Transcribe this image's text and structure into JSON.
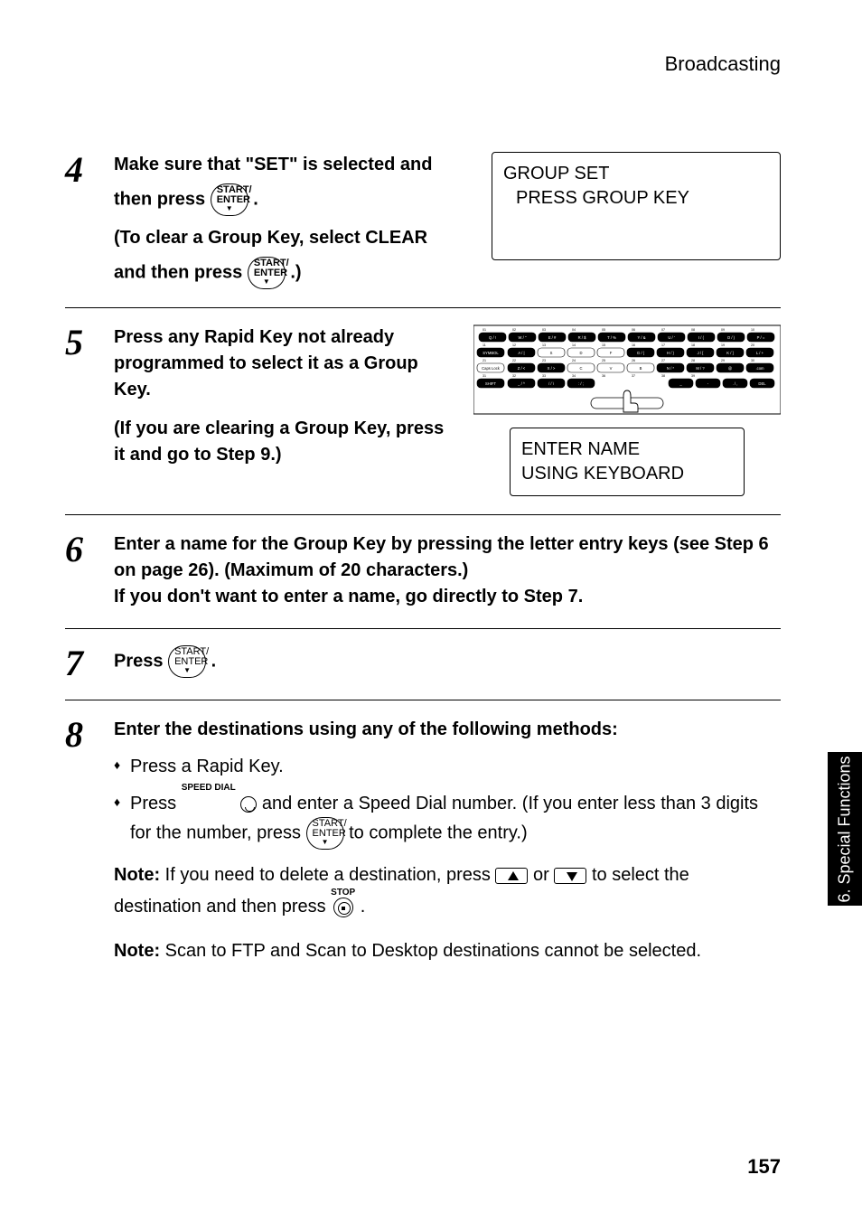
{
  "header": {
    "section_title": "Broadcasting"
  },
  "side_tab": {
    "label": "6. Special\nFunctions"
  },
  "page_number": "157",
  "buttons": {
    "start_enter_top": "START/",
    "start_enter_bottom": "ENTER",
    "speed_dial_label": "SPEED DIAL",
    "stop_label": "STOP"
  },
  "steps": {
    "s4": {
      "num": "4",
      "line1a": "Make sure that \"SET\" is selected and",
      "line1b": "then press ",
      "line1c": ".",
      "line2": "(To clear a Group Key, select CLEAR",
      "line3a": "and then press ",
      "line3b": ".)",
      "display_l1": "GROUP SET",
      "display_l2": "PRESS GROUP KEY"
    },
    "s5": {
      "num": "5",
      "p1": "Press any Rapid Key not already programmed to select it as a Group Key.",
      "p2": "(If you are clearing a Group Key, press it and go to Step 9.)",
      "display_l1": "ENTER NAME",
      "display_l2": "USING KEYBOARD"
    },
    "s6": {
      "num": "6",
      "p1": "Enter a name for the Group Key by pressing the letter entry keys (see Step 6 on page 26). (Maximum of 20 characters.)",
      "p2": "If you don't want to enter a name, go directly to Step 7."
    },
    "s7": {
      "num": "7",
      "p1a": "Press ",
      "p1b": "."
    },
    "s8": {
      "num": "8",
      "heading": "Enter the destinations using any of the following methods:",
      "b1": "Press a Rapid Key.",
      "b2a": "Press ",
      "b2b": " and enter a Speed Dial number. (If you enter less than 3 digits for the number, press ",
      "b2c": " to complete the entry.)",
      "note1a": "Note:",
      "note1b": " If you need to delete a destination, press ",
      "note1c": " or ",
      "note1d": " to select the destination and then press ",
      "note1e": " .",
      "note2a": "Note:",
      "note2b": " Scan to FTP and Scan to Desktop destinations cannot be selected."
    }
  },
  "keyboard": {
    "row_nums": [
      "01",
      "02",
      "03",
      "04",
      "05",
      "06",
      "07",
      "08",
      "09",
      "10"
    ],
    "row1": [
      "Q / !",
      "W / \"",
      "E / #",
      "R / $",
      "T / %",
      "Y / &",
      "U / '",
      "I / (",
      "O / )",
      "P / ="
    ],
    "row1_nums": [
      "11",
      "12",
      "13",
      "14",
      "15",
      "16",
      "17",
      "18",
      "19",
      "20"
    ],
    "row2_lead": "SYMBOL",
    "row2": [
      "A / |",
      "S",
      "D",
      "F",
      "G / {",
      "H / }",
      "J / [",
      "K / ]",
      "L / +"
    ],
    "row2_nums": [
      "21",
      "22",
      "23",
      "24",
      "25",
      "26",
      "27",
      "28",
      "29",
      "30"
    ],
    "row3_lead": "Caps Lock",
    "row3": [
      "Z / <",
      "X / >",
      "C",
      "V",
      "B",
      "N / *",
      "M / ?",
      "@",
      ".com"
    ],
    "row3_nums": [
      "31",
      "32",
      "33",
      "34",
      "36",
      "37",
      "38",
      "39"
    ],
    "row4_lead": "SHIFT",
    "row4_left": [
      "_ / ^",
      "/ / \\",
      ": / ;"
    ],
    "row4_right": [
      "_",
      "-",
      ". / ,",
      "DEL"
    ]
  }
}
